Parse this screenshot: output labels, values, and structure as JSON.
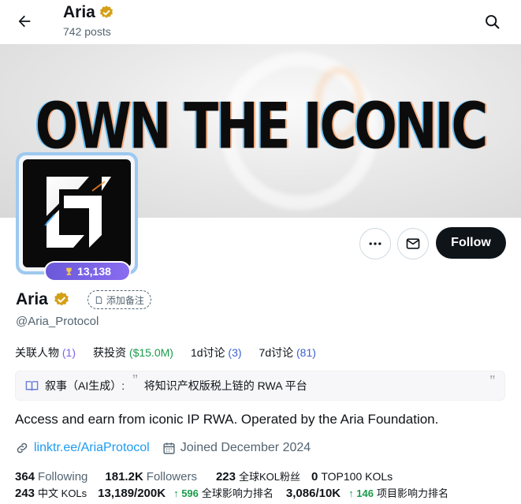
{
  "header": {
    "title": "Aria",
    "subtitle": "742 posts",
    "back_icon": "arrow-left-icon",
    "search_icon": "search-icon"
  },
  "banner": {
    "text": "OWN THE ICONIC"
  },
  "avatar": {
    "score": "13,138",
    "score_icon": "trophy-icon"
  },
  "actions": {
    "more_icon": "more-dots-icon",
    "message_icon": "mail-icon",
    "follow_label": "Follow"
  },
  "profile": {
    "name": "Aria",
    "verified_icon": "verified-badge-icon",
    "verified_color": "#d4a017",
    "note_label": "添加备注",
    "handle": "@Aria_Protocol"
  },
  "stats": [
    {
      "label": "关联人物",
      "value": "(1)"
    },
    {
      "label": "获投资",
      "value": "($15.0M)"
    },
    {
      "label": "1d讨论",
      "value": "(3)"
    },
    {
      "label": "7d讨论",
      "value": "(81)"
    }
  ],
  "narrative": {
    "label": "叙事（AI生成）:",
    "open_quote": "”",
    "text": "将知识产权版税上链的 RWA 平台",
    "close_quote": "”"
  },
  "bio": "Access and earn from iconic IP RWA. Operated by the Aria Foundation.",
  "meta": {
    "link": "linktr.ee/AriaProtocol",
    "joined": "Joined December 2024"
  },
  "follow_stats": {
    "following_count": "364",
    "following_label": "Following",
    "followers_count": "181.2K",
    "followers_label": "Followers",
    "global_kol_fans_count": "223",
    "global_kol_fans_label": "全球KOL粉丝",
    "top100_count": "0",
    "top100_label": "TOP100 KOLs"
  },
  "kol_stats": {
    "cn_kol_count": "243",
    "cn_kol_label": "中文 KOLs",
    "global_rank": "13,189/200K",
    "global_rank_change": "596",
    "global_rank_label": "全球影响力排名",
    "project_rank": "3,086/10K",
    "project_rank_change": "146",
    "project_rank_label": "项目影响力排名"
  },
  "colors": {
    "accent_blue": "#1d9bf0",
    "follow_bg": "#0f1419",
    "score_pill": "#7a63e6",
    "green": "#1a9c4b",
    "purple": "#7c63e8"
  }
}
